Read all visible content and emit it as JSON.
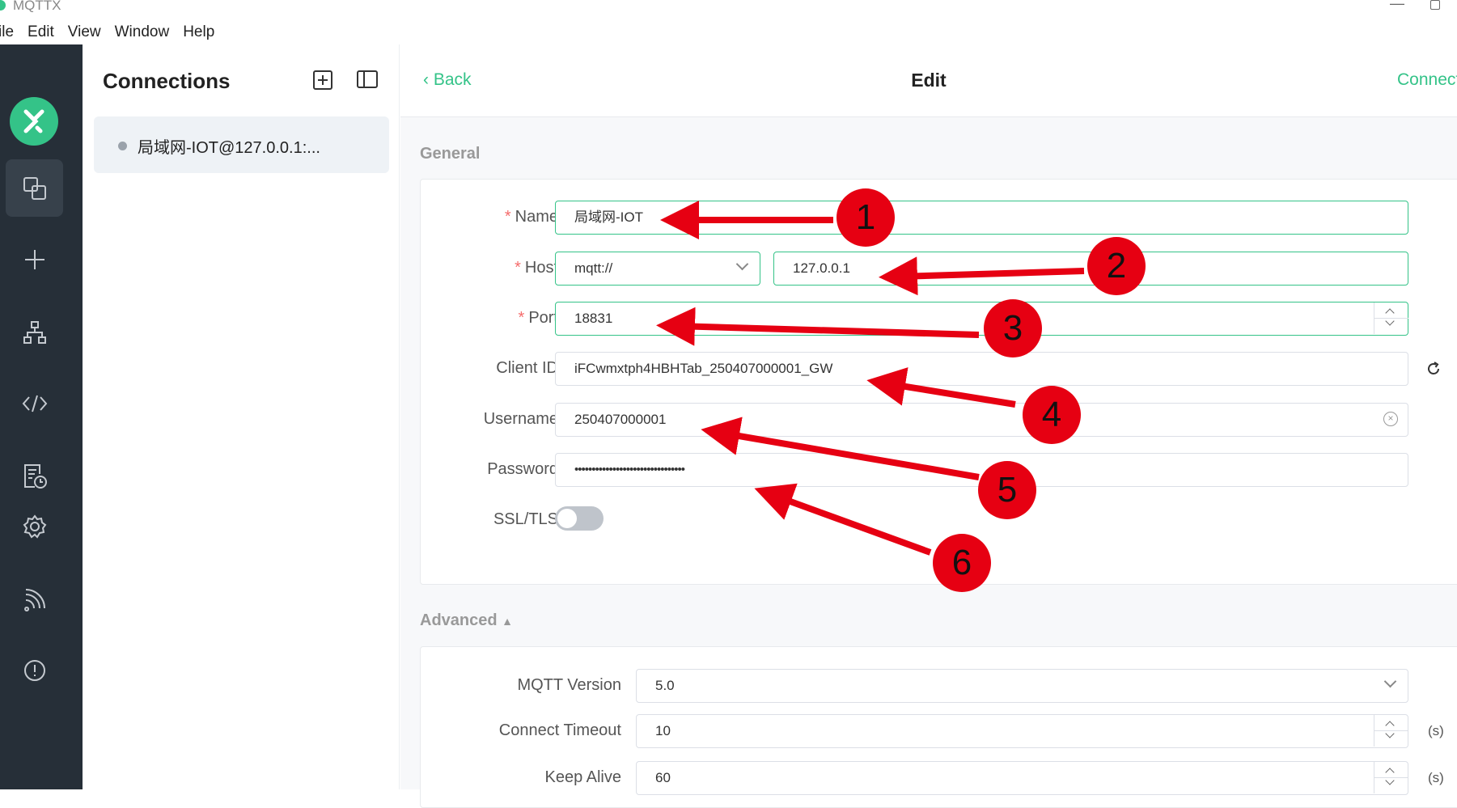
{
  "window": {
    "title": "MQTTX"
  },
  "menu": [
    "ile",
    "Edit",
    "View",
    "Window",
    "Help"
  ],
  "sidebar": {
    "items": [
      {
        "icon": "connections-icon",
        "active": true
      },
      {
        "icon": "plus-icon"
      },
      {
        "icon": "topology-icon"
      },
      {
        "icon": "code-icon"
      },
      {
        "icon": "log-icon"
      },
      {
        "icon": "gear-icon"
      },
      {
        "icon": "feed-icon"
      },
      {
        "icon": "info-icon"
      }
    ]
  },
  "connections": {
    "title": "Connections",
    "items": [
      {
        "label": "局域网-IOT@127.0.0.1:...",
        "status": "offline"
      }
    ]
  },
  "header": {
    "back": "Back",
    "title": "Edit",
    "connect": "Connect"
  },
  "general": {
    "section": "General",
    "name": {
      "label": "Name",
      "value": "局域网-IOT"
    },
    "host": {
      "label": "Host",
      "protocol": "mqtt://",
      "value": "127.0.0.1"
    },
    "port": {
      "label": "Port",
      "value": "18831"
    },
    "client_id": {
      "label": "Client ID",
      "value": "iFCwmxtph4HBHTab_250407000001_GW"
    },
    "username": {
      "label": "Username",
      "value": "250407000001"
    },
    "password": {
      "label": "Password",
      "value": "••••••••••••••••••••••••••••••••"
    },
    "ssl": {
      "label": "SSL/TLS",
      "enabled": false
    }
  },
  "advanced": {
    "section": "Advanced",
    "mqtt_version": {
      "label": "MQTT Version",
      "value": "5.0"
    },
    "connect_timeout": {
      "label": "Connect Timeout",
      "value": "10",
      "unit": "(s)"
    },
    "keep_alive": {
      "label": "Keep Alive",
      "value": "60",
      "unit": "(s)"
    }
  },
  "annotations": {
    "color": "#e60012",
    "badges": [
      "1",
      "2",
      "3",
      "4",
      "5",
      "6"
    ]
  },
  "colors": {
    "accent": "#34c388",
    "sidebar": "#262f38",
    "required": "#f56c6c"
  }
}
